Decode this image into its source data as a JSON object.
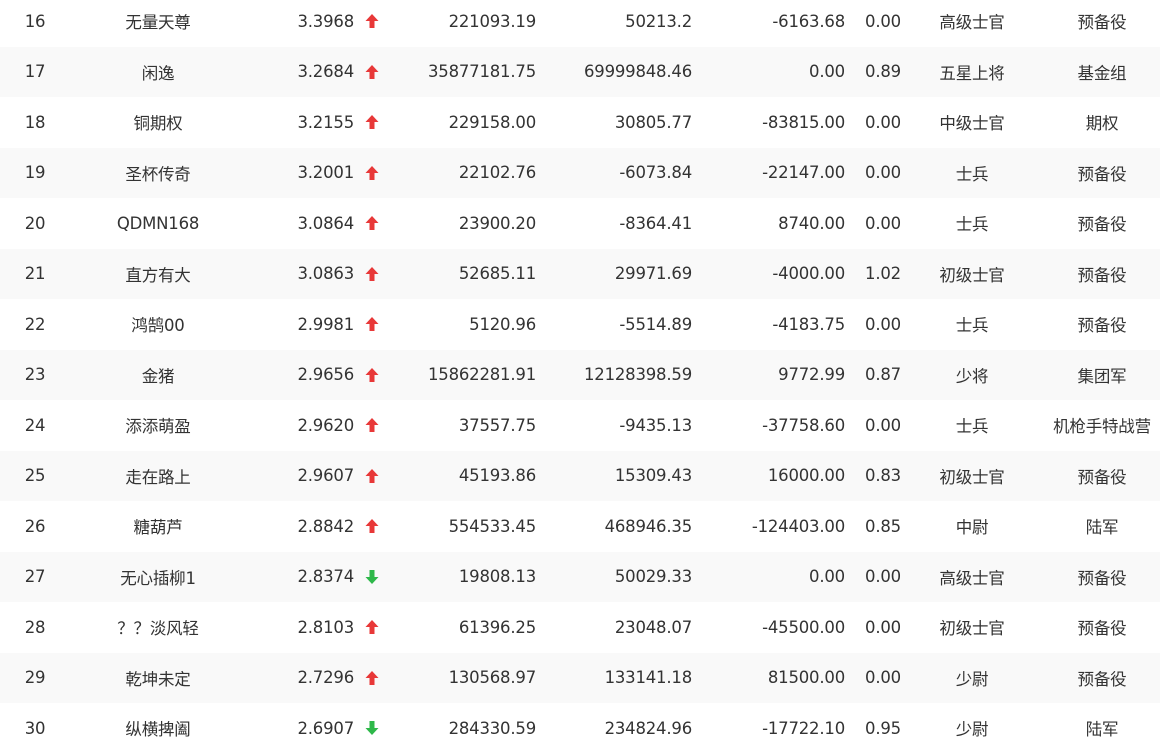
{
  "colors": {
    "up": "#e83838",
    "down": "#2eb84a",
    "text": "#333333"
  },
  "rows": [
    {
      "rank": "16",
      "name": "无量天尊",
      "score": "3.3968",
      "trend": "up",
      "trend_icon": "arrow-up-icon",
      "equity": "221093.19",
      "profit": "50213.2",
      "flow": "-6163.68",
      "ratio": "0.00",
      "level": "高级士官",
      "group": "预备役"
    },
    {
      "rank": "17",
      "name": "闲逸",
      "score": "3.2684",
      "trend": "up",
      "trend_icon": "arrow-up-icon",
      "equity": "35877181.75",
      "profit": "69999848.46",
      "flow": "0.00",
      "ratio": "0.89",
      "level": "五星上将",
      "group": "基金组"
    },
    {
      "rank": "18",
      "name": "铜期权",
      "score": "3.2155",
      "trend": "up",
      "trend_icon": "arrow-up-icon",
      "equity": "229158.00",
      "profit": "30805.77",
      "flow": "-83815.00",
      "ratio": "0.00",
      "level": "中级士官",
      "group": "期权"
    },
    {
      "rank": "19",
      "name": "圣杯传奇",
      "score": "3.2001",
      "trend": "up",
      "trend_icon": "arrow-up-icon",
      "equity": "22102.76",
      "profit": "-6073.84",
      "flow": "-22147.00",
      "ratio": "0.00",
      "level": "士兵",
      "group": "预备役"
    },
    {
      "rank": "20",
      "name": "QDMN168",
      "score": "3.0864",
      "trend": "up",
      "trend_icon": "arrow-up-icon",
      "equity": "23900.20",
      "profit": "-8364.41",
      "flow": "8740.00",
      "ratio": "0.00",
      "level": "士兵",
      "group": "预备役"
    },
    {
      "rank": "21",
      "name": "直方有大",
      "score": "3.0863",
      "trend": "up",
      "trend_icon": "arrow-up-icon",
      "equity": "52685.11",
      "profit": "29971.69",
      "flow": "-4000.00",
      "ratio": "1.02",
      "level": "初级士官",
      "group": "预备役"
    },
    {
      "rank": "22",
      "name": "鸿鹄00",
      "score": "2.9981",
      "trend": "up",
      "trend_icon": "arrow-up-icon",
      "equity": "5120.96",
      "profit": "-5514.89",
      "flow": "-4183.75",
      "ratio": "0.00",
      "level": "士兵",
      "group": "预备役"
    },
    {
      "rank": "23",
      "name": "金猪",
      "score": "2.9656",
      "trend": "up",
      "trend_icon": "arrow-up-icon",
      "equity": "15862281.91",
      "profit": "12128398.59",
      "flow": "9772.99",
      "ratio": "0.87",
      "level": "少将",
      "group": "集团军"
    },
    {
      "rank": "24",
      "name": "添添萌盈",
      "score": "2.9620",
      "trend": "up",
      "trend_icon": "arrow-up-icon",
      "equity": "37557.75",
      "profit": "-9435.13",
      "flow": "-37758.60",
      "ratio": "0.00",
      "level": "士兵",
      "group": "机枪手特战营"
    },
    {
      "rank": "25",
      "name": "走在路上",
      "score": "2.9607",
      "trend": "up",
      "trend_icon": "arrow-up-icon",
      "equity": "45193.86",
      "profit": "15309.43",
      "flow": "16000.00",
      "ratio": "0.83",
      "level": "初级士官",
      "group": "预备役"
    },
    {
      "rank": "26",
      "name": "糖葫芦",
      "score": "2.8842",
      "trend": "up",
      "trend_icon": "arrow-up-icon",
      "equity": "554533.45",
      "profit": "468946.35",
      "flow": "-124403.00",
      "ratio": "0.85",
      "level": "中尉",
      "group": "陆军"
    },
    {
      "rank": "27",
      "name": "无心插柳1",
      "score": "2.8374",
      "trend": "down",
      "trend_icon": "arrow-down-icon",
      "equity": "19808.13",
      "profit": "50029.33",
      "flow": "0.00",
      "ratio": "0.00",
      "level": "高级士官",
      "group": "预备役"
    },
    {
      "rank": "28",
      "name": "？？淡风轻",
      "score": "2.8103",
      "trend": "up",
      "trend_icon": "arrow-up-icon",
      "equity": "61396.25",
      "profit": "23048.07",
      "flow": "-45500.00",
      "ratio": "0.00",
      "level": "初级士官",
      "group": "预备役"
    },
    {
      "rank": "29",
      "name": "乾坤未定",
      "score": "2.7296",
      "trend": "up",
      "trend_icon": "arrow-up-icon",
      "equity": "130568.97",
      "profit": "133141.18",
      "flow": "81500.00",
      "ratio": "0.00",
      "level": "少尉",
      "group": "预备役"
    },
    {
      "rank": "30",
      "name": "纵横捭阖",
      "score": "2.6907",
      "trend": "down",
      "trend_icon": "arrow-down-icon",
      "equity": "284330.59",
      "profit": "234824.96",
      "flow": "-17722.10",
      "ratio": "0.95",
      "level": "少尉",
      "group": "陆军"
    }
  ]
}
